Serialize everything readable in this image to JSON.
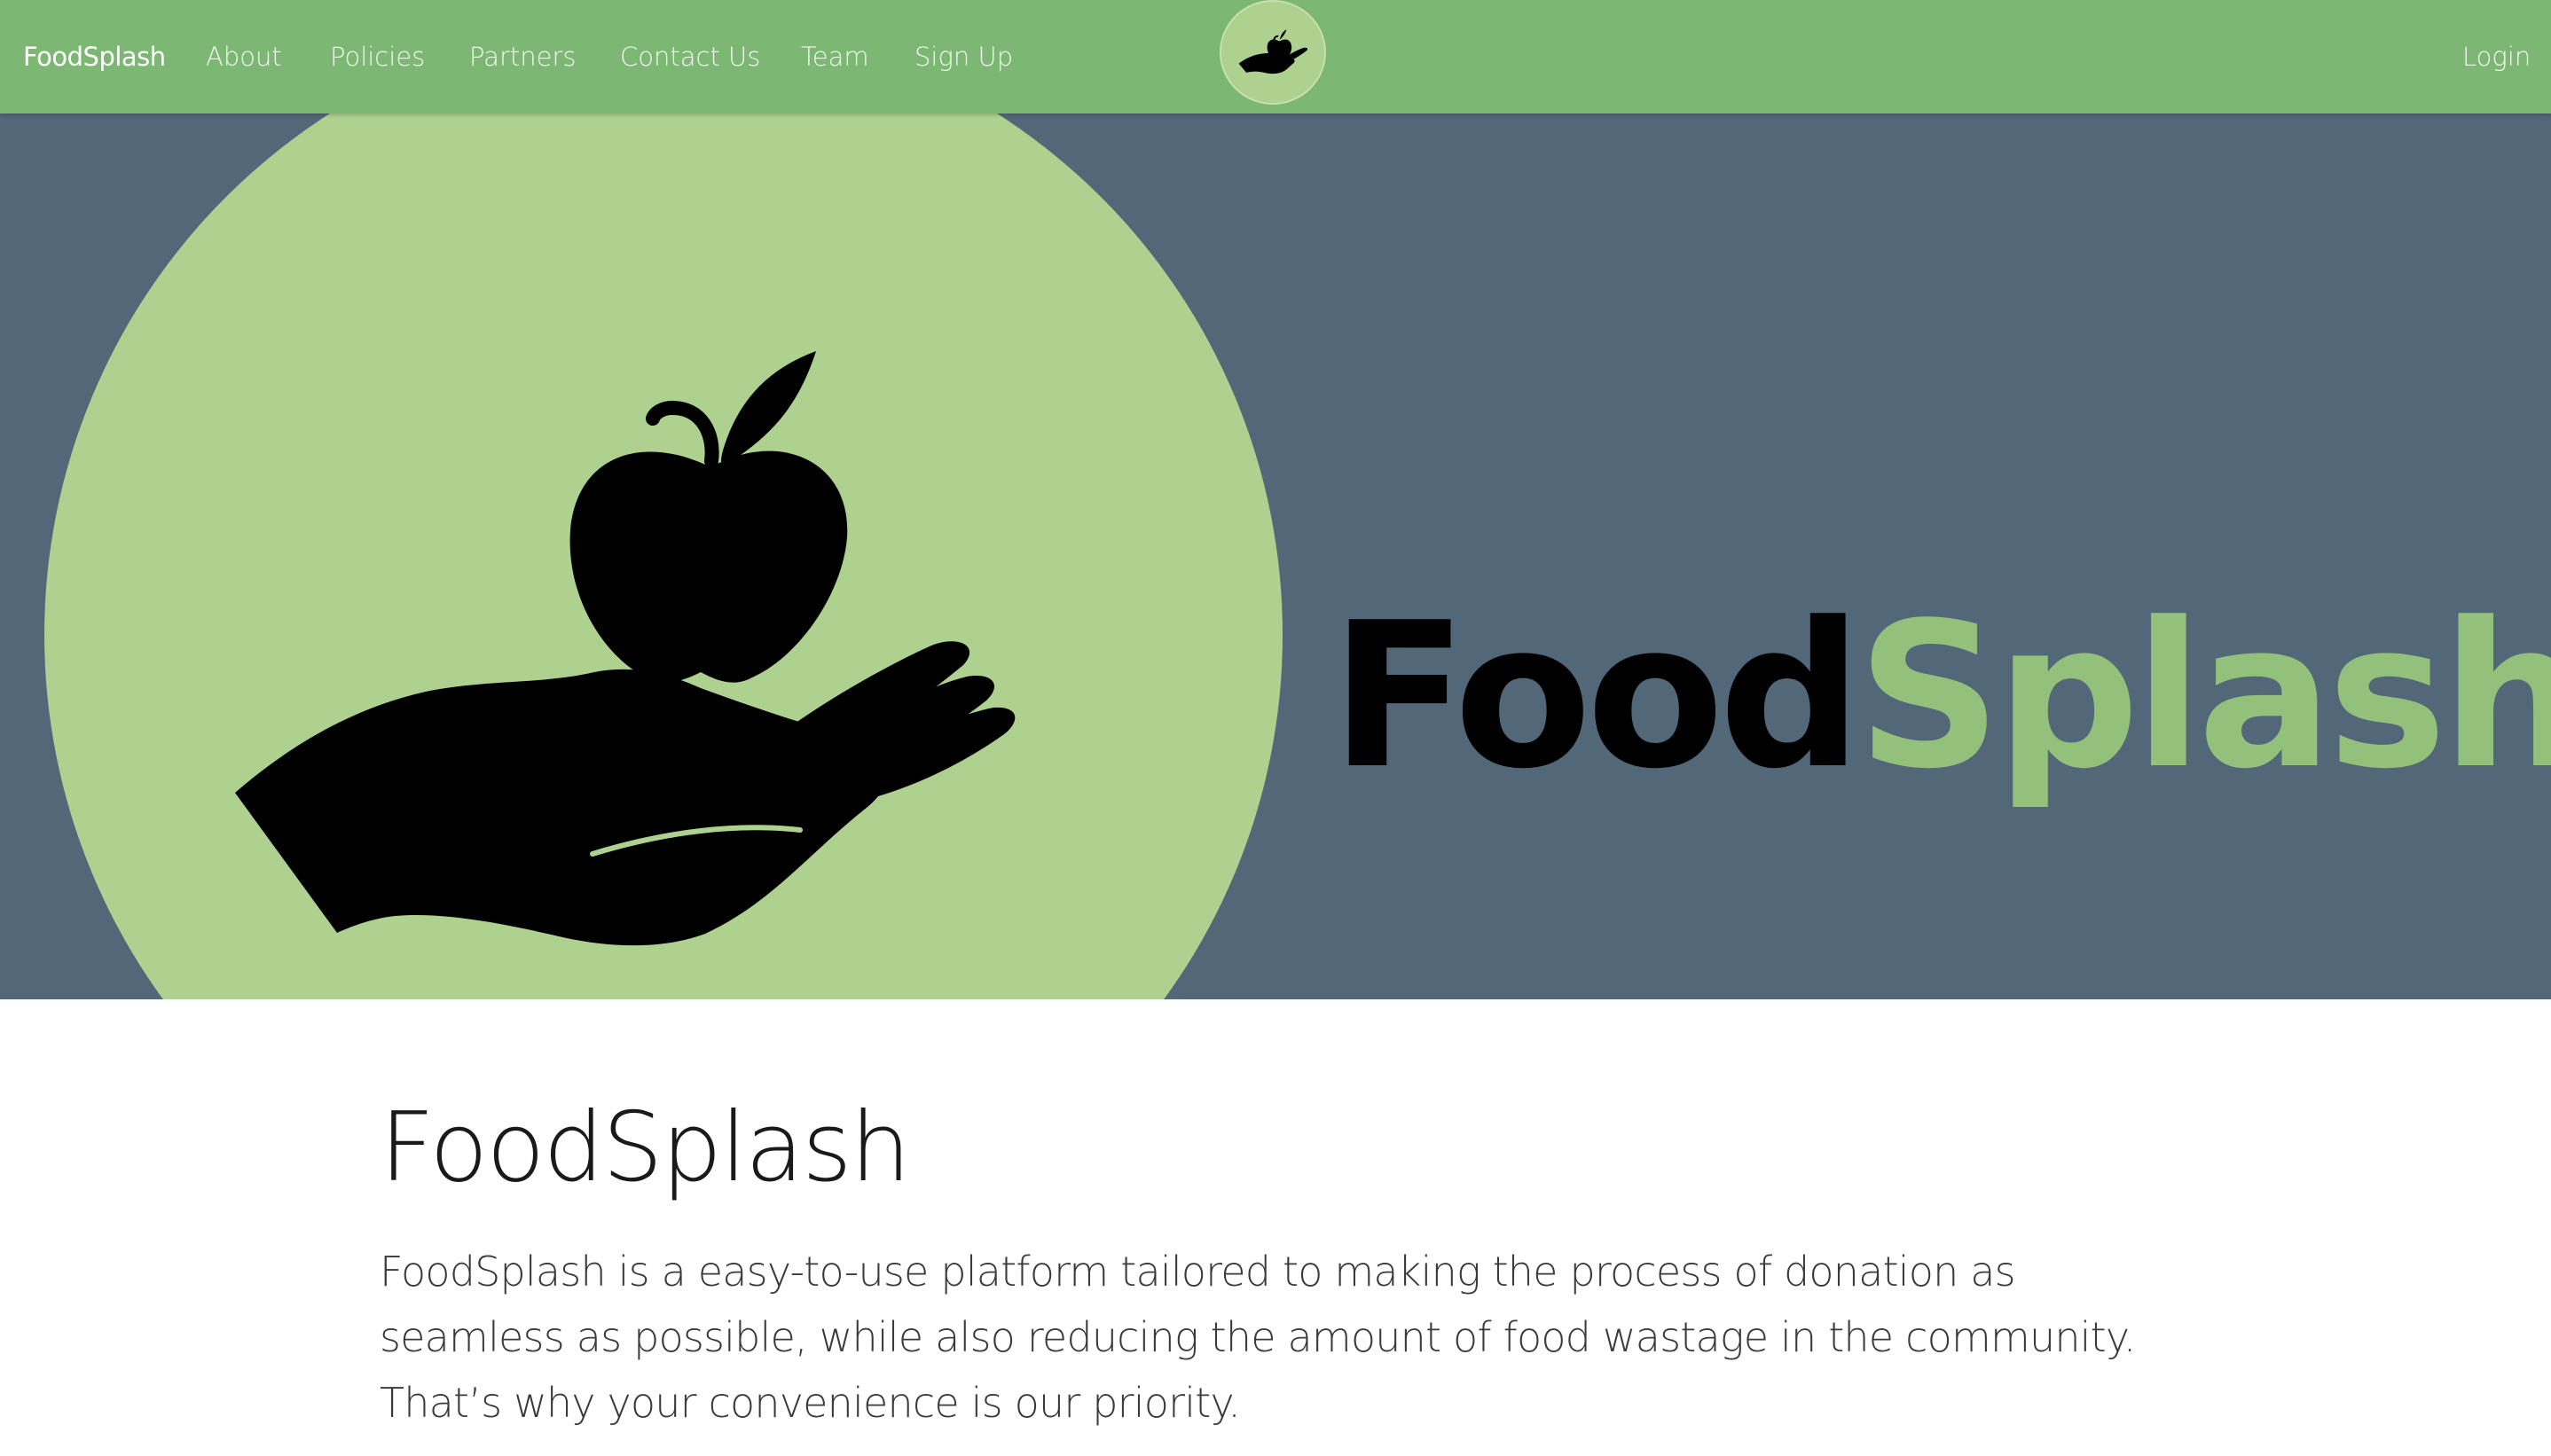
{
  "navbar": {
    "brand": "FoodSplash",
    "items": [
      {
        "label": "About"
      },
      {
        "label": "Policies"
      },
      {
        "label": "Partners"
      },
      {
        "label": "Contact Us"
      },
      {
        "label": "Team"
      },
      {
        "label": "Sign Up"
      }
    ],
    "login_label": "Login",
    "logo_icon": "apple-in-hand-icon"
  },
  "hero": {
    "wordmark_part1": "Food",
    "wordmark_part2": "Splash",
    "image_icon": "apple-in-hand-icon"
  },
  "main": {
    "title": "FoodSplash",
    "description": "FoodSplash is a easy-to-use platform tailored to making the process of donation as seamless as possible, while also reducing the amount of food wastage in the community. That’s why your convenience is our priority."
  },
  "colors": {
    "navbar_bg": "#7cb774",
    "hero_bg": "#526878",
    "hero_circle": "#aed18f",
    "accent_green": "#93c07b",
    "text_dark": "#1a1a1a"
  }
}
